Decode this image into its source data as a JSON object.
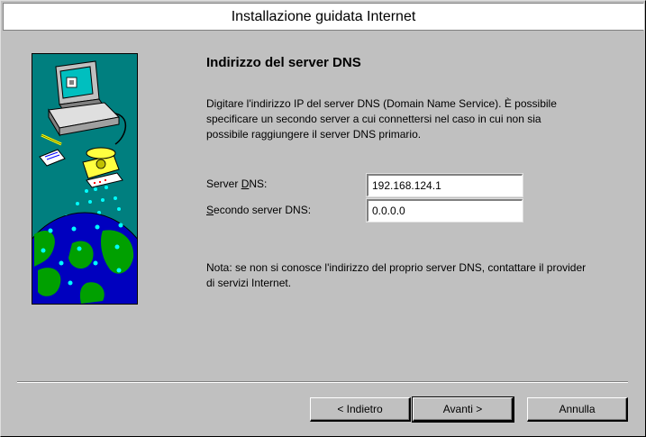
{
  "window": {
    "title": "Installazione guidata Internet"
  },
  "page": {
    "heading": "Indirizzo del server DNS",
    "description": "Digitare l'indirizzo IP del server DNS (Domain Name Service). È possibile specificare un secondo server a cui connettersi nel caso in cui non sia possibile raggiungere il server DNS primario.",
    "dns_label_prefix": "Server ",
    "dns_label_accel": "D",
    "dns_label_suffix": "NS:",
    "dns_value": "192.168.124.1",
    "dns2_label_accel": "S",
    "dns2_label_suffix": "econdo server DNS:",
    "dns2_value": "0.0.0.0",
    "note": "Nota: se non si conosce l'indirizzo del proprio server DNS, contattare il provider di servizi Internet."
  },
  "buttons": {
    "back": "< Indietro",
    "next": "Avanti >",
    "cancel": "Annulla"
  },
  "illustration": {
    "icon": "computer-phone-globe-illustration",
    "colors": {
      "background": "#007f7f",
      "ocean": "#0000bf",
      "land": "#00a000",
      "dots": "#00ffff"
    }
  }
}
